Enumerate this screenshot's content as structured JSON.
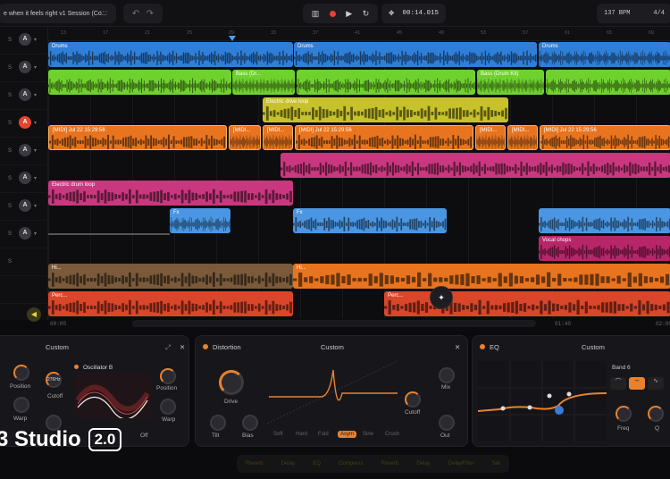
{
  "header": {
    "session_title": "e when it feels right v1 Session (Co...",
    "more_icon": "ellipsis-icon",
    "undo_icon": "undo-icon",
    "redo_icon": "redo-icon",
    "transport": {
      "mixer_icon": "mixer-icon",
      "record_icon": "record-icon",
      "play_icon": "play-icon",
      "loop_icon": "loop-icon"
    },
    "time": "00:14.015",
    "tempo": "137 BPM",
    "signature": "4/4"
  },
  "tracks": [
    {
      "s": "S",
      "a": "A",
      "armed": false
    },
    {
      "s": "S",
      "a": "A",
      "armed": false
    },
    {
      "s": "S",
      "a": "A",
      "armed": false
    },
    {
      "s": "S",
      "a": "A",
      "armed": true
    },
    {
      "s": "S",
      "a": "A",
      "armed": false
    },
    {
      "s": "S",
      "a": "A",
      "armed": false
    },
    {
      "s": "S",
      "a": "A",
      "armed": false
    },
    {
      "s": "S",
      "a": "A",
      "armed": false
    },
    {
      "s": "S",
      "a": "",
      "armed": false
    },
    {
      "s": "",
      "a": "",
      "armed": false
    }
  ],
  "ruler_marks": [
    "13",
    "17",
    "21",
    "25",
    "29",
    "33",
    "37",
    "41",
    "45",
    "49",
    "53",
    "57",
    "61",
    "65",
    "69"
  ],
  "time_marks": [
    "00:00",
    "00:20",
    "00:40",
    "01:00",
    "01:20",
    "01:40",
    "02:00"
  ],
  "clips": {
    "drums": "Drums",
    "bass_a": "Bass (Dr...",
    "bass_b": "Bass (Drum Kit)",
    "guitar": "Electric drive loop",
    "midi_a": "[MIDI] Jul 22 15:29:56",
    "midi_b": "[MIDI...",
    "midi_c": "[MIDI] Jul 22 15:29:56",
    "midi_d": "[MIDI...",
    "midi_e": "[MIDI...",
    "midi_f": "[MIDI] Jul 22 15:29:56",
    "drumloop": "Electric drum loop",
    "fx": "Fx",
    "vocal": "Vocal chops",
    "hi": "Hi...",
    "perc": "Perc..."
  },
  "synth_panel": {
    "preset": "Custom",
    "osc_b": "Oscillator B",
    "position_a": "Position",
    "warp_a": "Warp",
    "cutoff": "Cutoff",
    "freq": "276Hz",
    "position_b": "Position",
    "warp_b": "Warp",
    "off": "Off"
  },
  "distortion_panel": {
    "title": "Distortion",
    "preset": "Custom",
    "drive": "Drive",
    "mix": "Mix",
    "cutoff": "Cutoff",
    "tilt": "Tilt",
    "bias": "Bias",
    "out": "Out",
    "modes": [
      "Soft",
      "Hard",
      "Fold",
      "Asym",
      "Sine",
      "Crush"
    ],
    "active_mode": "Asym"
  },
  "eq_panel": {
    "title": "EQ",
    "preset": "Custom",
    "band": "Band 6",
    "freq": "Freq",
    "q": "Q"
  },
  "brand": {
    "name": "Studio",
    "version": "2.0"
  },
  "fx_chain": [
    "Reverb",
    "Delay",
    "EQ",
    "Compress",
    "Reverb",
    "Delay",
    "DelayFilter",
    "Sat"
  ],
  "colors": {
    "drums": "#2f7fd8",
    "bass": "#6fd12e",
    "guitar": "#c8c22a",
    "midi": "#e8741f",
    "pink": "#c9387f",
    "fx": "#4a96e2",
    "vocal": "#b8266a",
    "hi": "#7a5a3a",
    "perc": "#d9462a",
    "accent": "#e8822f"
  }
}
